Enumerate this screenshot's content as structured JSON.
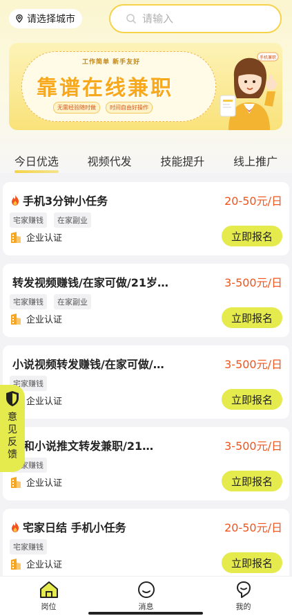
{
  "header": {
    "city_label": "请选择城市",
    "search_placeholder": "请输入"
  },
  "banner": {
    "subtitle": "工作简单  新手友好",
    "title": "靠谱在线兼职",
    "tags": [
      "无需经验随时做",
      "时间自由好操作"
    ],
    "figure_badge": "手机兼职"
  },
  "tabs": [
    {
      "label": "今日优选",
      "active": true
    },
    {
      "label": "视频代发",
      "active": false
    },
    {
      "label": "技能提升",
      "active": false
    },
    {
      "label": "线上推广",
      "active": false
    }
  ],
  "jobs": [
    {
      "title": "手机3分钟小任务",
      "hot": true,
      "salary": "20-50元/日",
      "tags": [
        "宅家赚钱",
        "在家副业"
      ],
      "company": "企业认证",
      "apply": "立即报名"
    },
    {
      "title": "转发视频赚钱/在家可做/21岁…",
      "hot": false,
      "salary": "3-500元/日",
      "tags": [
        "宅家赚钱",
        "在家副业"
      ],
      "company": "企业认证",
      "apply": "立即报名"
    },
    {
      "title": "小说视频转发赚钱/在家可做/…",
      "hot": false,
      "salary": "3-500元/日",
      "tags": [
        "宅家赚钱"
      ],
      "company": "企业认证",
      "apply": "立即报名"
    },
    {
      "title": "频和小说推文转发兼职/21…",
      "hot": false,
      "salary": "3-500元/日",
      "tags": [
        "宅家赚钱"
      ],
      "company": "企业认证",
      "apply": "立即报名"
    },
    {
      "title": "宅家日结 手机小任务",
      "hot": true,
      "salary": "20-50元/日",
      "tags": [
        "宅家赚钱"
      ],
      "company": "企业认证",
      "apply": "立即报名"
    }
  ],
  "feedback": {
    "chars": [
      "意",
      "见",
      "反",
      "馈"
    ]
  },
  "bottom_nav": [
    {
      "label": "岗位",
      "icon": "home-icon",
      "active": true
    },
    {
      "label": "消息",
      "icon": "message-icon",
      "active": false
    },
    {
      "label": "我的",
      "icon": "profile-icon",
      "active": false
    }
  ],
  "colors": {
    "accent": "#e5ea4d",
    "salary": "#f0541c",
    "search_border": "#f6d24a",
    "company_icon": "#f6a623"
  }
}
